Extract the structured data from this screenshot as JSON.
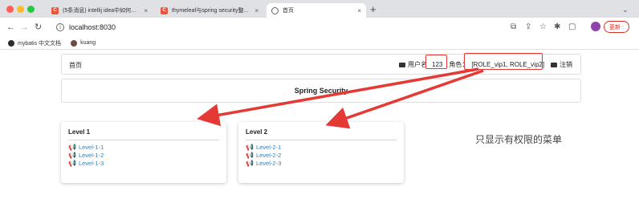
{
  "browser": {
    "tabs": [
      {
        "title": "(5条消息) intellij idea中如何快...",
        "favicon": "C",
        "favicon_color": "#e8543c",
        "active": false
      },
      {
        "title": "thymeleaf与spring security整...",
        "favicon": "C",
        "favicon_color": "#e8543c",
        "active": false
      },
      {
        "title": "首页",
        "favicon": "globe",
        "favicon_color": "#5f6368",
        "active": true
      }
    ],
    "new_tab": "+",
    "url": "localhost:8030",
    "update_label": "更新 :",
    "bookmarks": [
      {
        "label": "mybatis 中文文档",
        "color": "#2c2c2c"
      },
      {
        "label": "kuang",
        "color": "#6d4c41"
      }
    ]
  },
  "page": {
    "menu": {
      "home": "首页",
      "username_label": "用户名",
      "username": "123",
      "role_label": "角色",
      "roles": "[ROLE_vip1, ROLE_vip2]",
      "logout": "注销"
    },
    "banner": "Spring Security",
    "cards": [
      {
        "title": "Level 1",
        "items": [
          "Level-1-1",
          "Level-1-2",
          "Level-1-3"
        ]
      },
      {
        "title": "Level 2",
        "items": [
          "Level-2-1",
          "Level-2-2",
          "Level-2-3"
        ]
      }
    ],
    "annotation": "只显示有权限的菜单"
  },
  "colors": {
    "highlight": "#e53935",
    "link": "#2185d0"
  }
}
